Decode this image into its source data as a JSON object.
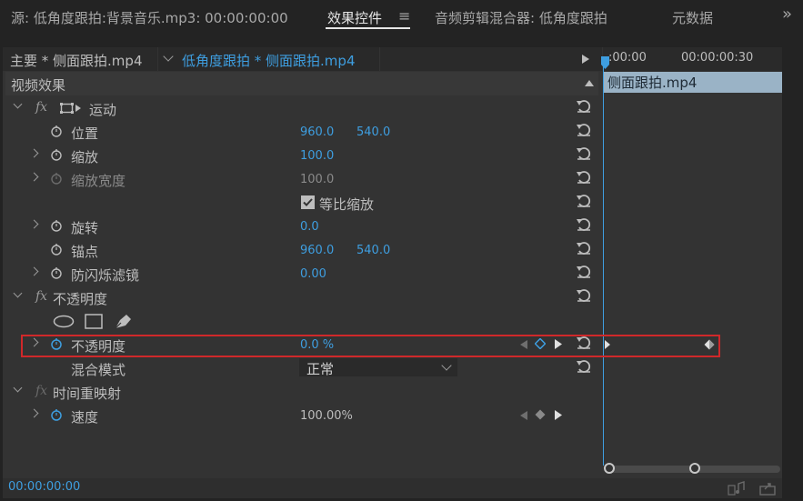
{
  "tabs": {
    "source": "源: 低角度跟拍:背景音乐.mp3: 00:00:00:00",
    "effect_controls": "效果控件",
    "menu_icon": "≡",
    "audio_mixer": "音频剪辑混合器: 低角度跟拍",
    "metadata": "元数据",
    "overflow": "»"
  },
  "header": {
    "master_clip": "主要 * 侧面跟拍.mp4",
    "sequence_clip": "低角度跟拍 * 侧面跟拍.mp4",
    "time_start": ":00:00",
    "time_end": "00:00:00:30",
    "clip_bar": "侧面跟拍.mp4"
  },
  "section": {
    "video_effects": "视频效果"
  },
  "motion": {
    "title": "运动",
    "position": {
      "label": "位置",
      "x": "960.0",
      "y": "540.0"
    },
    "scale": {
      "label": "缩放",
      "value": "100.0"
    },
    "scale_width": {
      "label": "缩放宽度",
      "value": "100.0"
    },
    "uniform_scale": {
      "label": "等比缩放",
      "checked": true
    },
    "rotation": {
      "label": "旋转",
      "value": "0.0"
    },
    "anchor": {
      "label": "锚点",
      "x": "960.0",
      "y": "540.0"
    },
    "anti_flicker": {
      "label": "防闪烁滤镜",
      "value": "0.00"
    }
  },
  "opacity": {
    "title": "不透明度",
    "opacity": {
      "label": "不透明度",
      "value": "0.0 %"
    },
    "blend_mode": {
      "label": "混合模式",
      "value": "正常"
    }
  },
  "time_remap": {
    "title": "时间重映射",
    "speed": {
      "label": "速度",
      "value": "100.00%"
    }
  },
  "footer": {
    "timecode": "00:00:00:00"
  },
  "colors": {
    "accent_blue": "#3e9ee0",
    "highlight_red": "#d0282a",
    "bg": "#333333"
  },
  "icons": [
    "reset-icon",
    "stopwatch-icon",
    "fx-icon",
    "ellipse-mask-icon",
    "rectangle-mask-icon",
    "pen-mask-icon",
    "keyframe-diamond-icon",
    "chevron-icon",
    "checkbox-icon"
  ]
}
